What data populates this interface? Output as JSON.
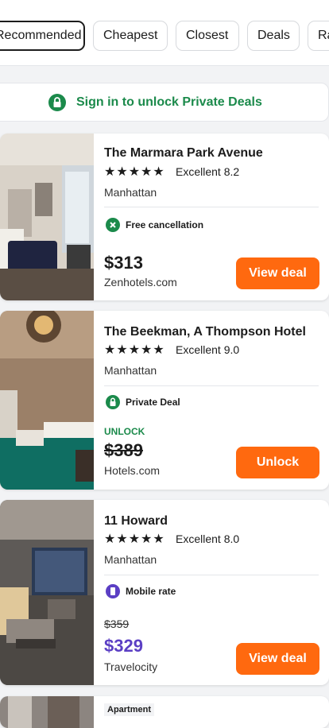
{
  "filters": [
    {
      "label": "Recommended",
      "active": true
    },
    {
      "label": "Cheapest",
      "active": false
    },
    {
      "label": "Closest",
      "active": false
    },
    {
      "label": "Deals",
      "active": false
    },
    {
      "label": "Rating",
      "active": false
    }
  ],
  "banner": {
    "text": "Sign in to unlock Private Deals",
    "icon": "lock-icon"
  },
  "hotels": [
    {
      "name": "The Marmara Park Avenue",
      "stars": "★★★★★",
      "rating": "Excellent 8.2",
      "location": "Manhattan",
      "feature": "Free cancellation",
      "feature_icon": "cancel-icon",
      "price": "$313",
      "provider": "Zenhotels.com",
      "button": "View deal"
    },
    {
      "name": "The Beekman, A Thompson Hotel",
      "stars": "★★★★★",
      "rating": "Excellent 9.0",
      "location": "Manhattan",
      "feature": "Private Deal",
      "feature_icon": "lock-icon",
      "unlock_label": "UNLOCK",
      "price": "$389",
      "provider": "Hotels.com",
      "button": "Unlock"
    },
    {
      "name": "11 Howard",
      "stars": "★★★★★",
      "rating": "Excellent 8.0",
      "location": "Manhattan",
      "feature": "Mobile rate",
      "feature_icon": "mobile-icon",
      "old_price": "$359",
      "price": "$329",
      "provider": "Travelocity",
      "button": "View deal"
    }
  ],
  "next_card": {
    "badge": "Apartment"
  },
  "colors": {
    "accent": "#ff690f",
    "green": "#1b8a4b",
    "purple": "#5b3fc4"
  }
}
